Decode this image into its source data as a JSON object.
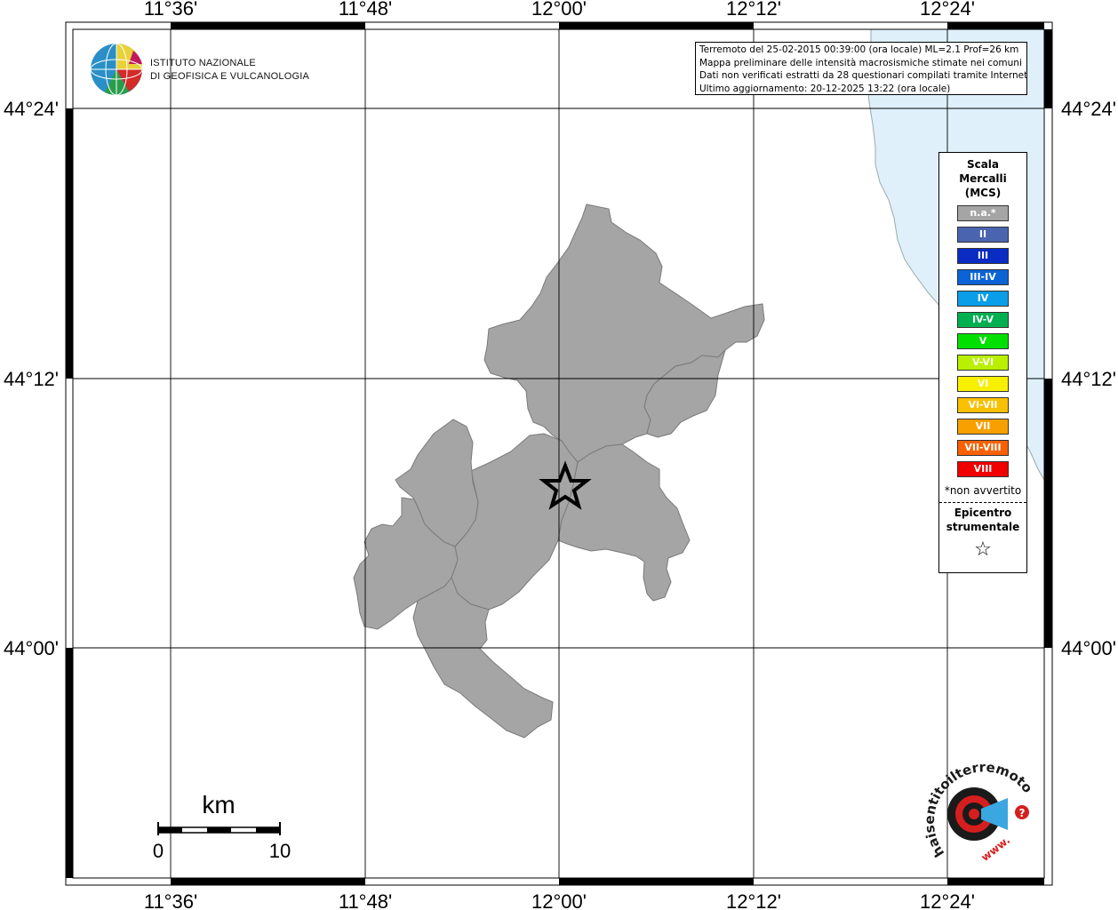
{
  "map": {
    "top_labels": [
      "11°36'",
      "11°48'",
      "12°00'",
      "12°12'",
      "12°24'"
    ],
    "bottom_labels": [
      "11°36'",
      "11°48'",
      "12°00'",
      "12°12'",
      "12°24'"
    ],
    "left_labels": [
      "44°24'",
      "44°12'",
      "44°00'"
    ],
    "right_labels": [
      "44°24'",
      "44°12'",
      "44°00'"
    ],
    "sea_color": "#dff0fb",
    "land_fill": "#a5a5a5",
    "epicenter_marker": "star-icon"
  },
  "logo": {
    "line1": "ISTITUTO NAZIONALE",
    "line2": "DI GEOFISICA E VULCANOLOGIA"
  },
  "info": {
    "line1": "Terremoto del 25-02-2015 00:39:00 (ora locale) ML=2.1 Prof=26 km",
    "line2": "Mappa preliminare delle intensità macrosismiche stimate nei comuni",
    "line3": "Dati non verificati estratti da 28 questionari compilati tramite Internet.",
    "line4": "Ultimo aggiornamento: 20-12-2025 13:22 (ora locale)"
  },
  "legend": {
    "title1": "Scala",
    "title2": "Mercalli",
    "title3": "(MCS)",
    "items": [
      {
        "label": "n.a.*",
        "color": "#a5a5a5"
      },
      {
        "label": "II",
        "color": "#4a64b0"
      },
      {
        "label": "III",
        "color": "#0a2cc4"
      },
      {
        "label": "III-IV",
        "color": "#0a64d6"
      },
      {
        "label": "IV",
        "color": "#0a9ee8"
      },
      {
        "label": "IV-V",
        "color": "#00b050"
      },
      {
        "label": "V",
        "color": "#00e000"
      },
      {
        "label": "V-VI",
        "color": "#b8f000"
      },
      {
        "label": "VI",
        "color": "#f8f000"
      },
      {
        "label": "VI-VII",
        "color": "#f8c000"
      },
      {
        "label": "VII",
        "color": "#f8a000"
      },
      {
        "label": "VII-VIII",
        "color": "#f86000"
      },
      {
        "label": "VIII",
        "color": "#f00000"
      }
    ],
    "note": "*non avvertito",
    "epi1": "Epicentro",
    "epi2": "strumentale",
    "epi_symbol": "☆"
  },
  "scale_bar": {
    "unit": "km",
    "min": "0",
    "max": "10"
  },
  "brand": {
    "text": "haisentitoilterremoto.it",
    "url_text": "www.",
    "question": "?"
  }
}
